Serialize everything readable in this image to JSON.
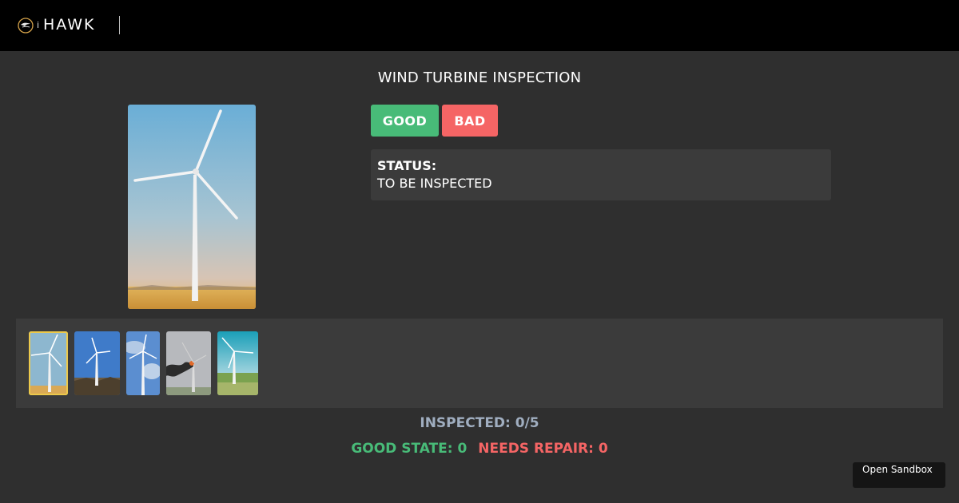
{
  "header": {
    "brand_prefix": "i",
    "brand": "HAWK",
    "logo_icon": "hawk-logo-icon"
  },
  "page": {
    "title": "WIND TURBINE INSPECTION"
  },
  "actions": {
    "good_label": "GOOD",
    "bad_label": "BAD"
  },
  "status": {
    "label": "STATUS:",
    "value": "TO BE INSPECTED"
  },
  "gallery": {
    "selected_index": 0,
    "images": [
      {
        "name": "turbine-photo-1",
        "subject": "wind turbine, clear sky over wheat field"
      },
      {
        "name": "turbine-photo-2",
        "subject": "wind turbine, blue sky over rocky hill"
      },
      {
        "name": "turbine-photo-3",
        "subject": "wind turbine, blue cloudy sky"
      },
      {
        "name": "turbine-photo-4",
        "subject": "burning wind turbine, grey sky"
      },
      {
        "name": "turbine-photo-5",
        "subject": "wind turbine, green field"
      }
    ]
  },
  "summary": {
    "inspected": "INSPECTED: 0/5",
    "good_state": "GOOD STATE: 0",
    "needs_repair": "NEEDS REPAIR: 0"
  },
  "sandbox": {
    "label": "Open Sandbox"
  },
  "colors": {
    "good": "#48bb78",
    "bad": "#f56565",
    "background": "#2f2f2f",
    "header": "#000000",
    "panel": "#3b3b3b",
    "selected_outline": "#ecc94b",
    "muted_text": "#a0aec0"
  }
}
